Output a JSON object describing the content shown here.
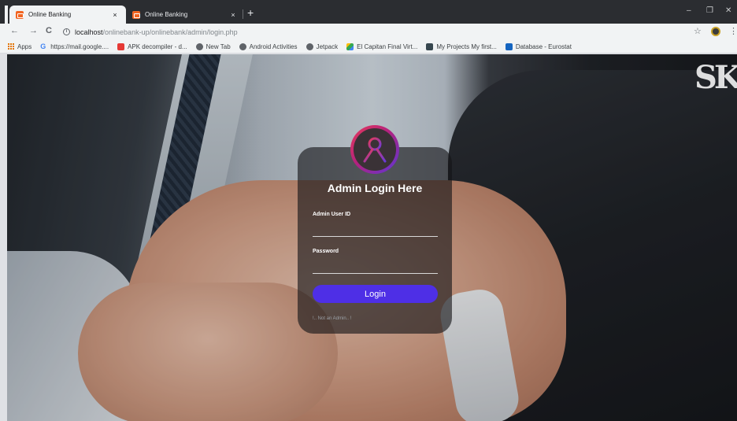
{
  "browser": {
    "tabs": [
      {
        "title": "Online Banking",
        "close": "×"
      },
      {
        "title": "Online Banking",
        "close": "×"
      }
    ],
    "new_tab": "+",
    "window_controls": {
      "minimize": "–",
      "maximize": "❐",
      "close": "✕"
    },
    "nav": {
      "back": "←",
      "forward": "→",
      "reload": "C",
      "info": "i"
    },
    "url": {
      "host": "localhost",
      "path": "/onlinebank-up/onlinebank/admin/login.php"
    },
    "star": "☆",
    "menu": "⋮"
  },
  "bookmarks": [
    {
      "label": "Apps",
      "icon": "apps-grid-icon",
      "color": "#e37400"
    },
    {
      "label": "https://mail.google....",
      "icon": "google-g-icon",
      "color": "#4285f4"
    },
    {
      "label": "APK decompiler - d...",
      "icon": "apk-icon",
      "color": "#e53935"
    },
    {
      "label": "New Tab",
      "icon": "globe-icon",
      "color": "#5f6368"
    },
    {
      "label": "Android Activities",
      "icon": "android-icon",
      "color": "#5f6368"
    },
    {
      "label": "Jetpack",
      "icon": "globe-icon",
      "color": "#5f6368"
    },
    {
      "label": "El Capitan Final Virt...",
      "icon": "drive-icon",
      "color": "#34a853"
    },
    {
      "label": "My Projects My first...",
      "icon": "project-icon",
      "color": "#37474f"
    },
    {
      "label": "Database - Eurostat",
      "icon": "eurostat-icon",
      "color": "#1565c0"
    }
  ],
  "page": {
    "brand": "SK",
    "login": {
      "title": "Admin Login Here",
      "user_label": "Admin User ID",
      "user_value": "",
      "password_label": "Password",
      "password_value": "",
      "button": "Login",
      "not_admin": "!.. Not an Admin.. !"
    }
  },
  "colors": {
    "accent": "#4e2fe6",
    "avatar_gradient_start": "#e83a5a",
    "avatar_gradient_end": "#5a36d8"
  }
}
